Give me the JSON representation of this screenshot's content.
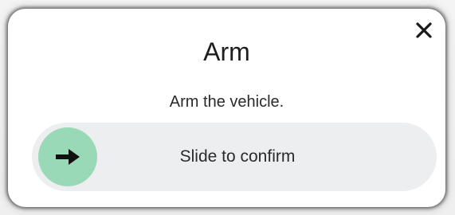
{
  "dialog": {
    "title": "Arm",
    "message": "Arm the vehicle.",
    "close_icon": "close-icon"
  },
  "slider": {
    "label": "Slide to confirm",
    "handle_icon": "arrow-right-icon",
    "handle_color": "#9ad9b7",
    "track_color": "#eceef0"
  }
}
